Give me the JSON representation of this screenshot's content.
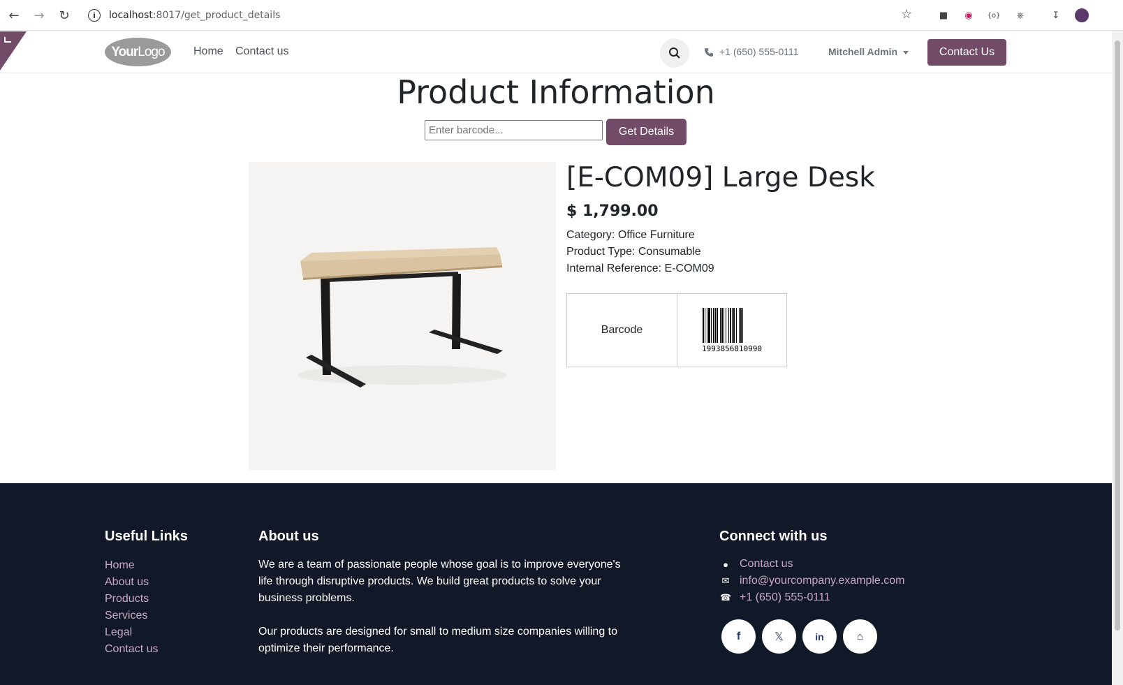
{
  "browser": {
    "url_host": "localhost",
    "url_rest": ":8017/get_product_details"
  },
  "header": {
    "logo_bold": "Your",
    "logo_light": "Logo",
    "menu": [
      "Home",
      "Contact us"
    ],
    "phone": "+1 (650) 555-0111",
    "user": "Mitchell Admin",
    "contact_button": "Contact Us"
  },
  "main": {
    "title": "Product Information",
    "barcode_placeholder": "Enter barcode...",
    "get_details_label": "Get Details",
    "product": {
      "name": "[E-COM09] Large Desk",
      "price": "$ 1,799.00",
      "category": "Category: Office Furniture",
      "product_type": "Product Type: Consumable",
      "internal_reference": "Internal Reference: E-COM09",
      "barcode_label": "Barcode",
      "barcode_number": "1993856810990"
    }
  },
  "footer": {
    "useful_links_title": "Useful Links",
    "useful_links": [
      "Home",
      "About us",
      "Products",
      "Services",
      "Legal",
      "Contact us"
    ],
    "about_title": "About us",
    "about_p1": "We are a team of passionate people whose goal is to improve everyone's life through disruptive products. We build great products to solve your business problems.",
    "about_p2": "Our products are designed for small to medium size companies willing to optimize their performance.",
    "connect_title": "Connect with us",
    "contact_link": "Contact us",
    "email": "info@yourcompany.example.com",
    "phone": "+1 (650) 555-0111",
    "social": [
      "facebook-icon",
      "x-icon",
      "linkedin-icon",
      "home-icon"
    ]
  },
  "colors": {
    "brand": "#714b67",
    "footer_bg": "#111827",
    "footer_link": "#c9a9c2"
  }
}
